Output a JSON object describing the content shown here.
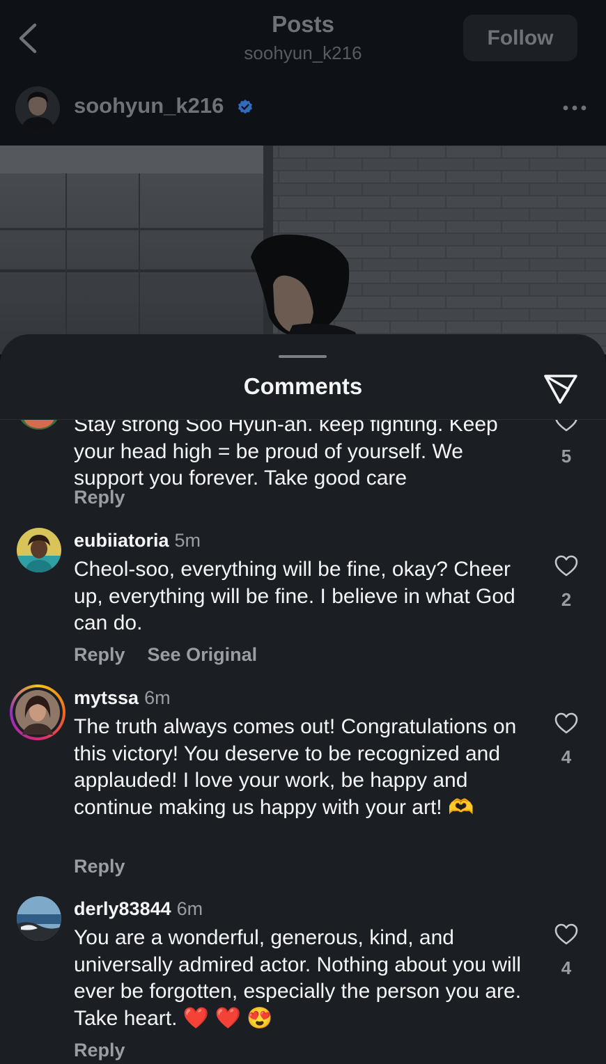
{
  "nav": {
    "title": "Posts",
    "subtitle": "soohyun_k216",
    "follow_label": "Follow"
  },
  "post": {
    "username": "soohyun_k216",
    "verified_color": "#3b82f6"
  },
  "sheet": {
    "title": "Comments"
  },
  "comments": [
    {
      "username": "",
      "time": "",
      "text": "Stay strong Soo Hyun-ah. keep fighting. Keep your head high = be proud of yourself. We support you forever. Take good care",
      "likes": "5",
      "reply_label": "Reply"
    },
    {
      "username": "eubiiatoria",
      "time": "5m",
      "text": "Cheol-soo, everything will be fine, okay? Cheer up, everything will be fine. I believe in what God can do.",
      "likes": "2",
      "reply_label": "Reply",
      "see_original_label": "See Original"
    },
    {
      "username": "mytssa",
      "time": "6m",
      "text": "The truth always comes out! Congratulations on this victory! You deserve to be recognized and applauded! I love your work, be happy and continue making us happy with your art! 🫶",
      "likes": "4",
      "reply_label": "Reply"
    },
    {
      "username": "derly83844",
      "time": "6m",
      "text": "You are a wonderful, generous, kind, and universally admired actor. Nothing about you will ever be forgotten, especially the person you are. Take heart. ❤️ ❤️ 😍",
      "likes": "4",
      "reply_label": "Reply"
    }
  ]
}
